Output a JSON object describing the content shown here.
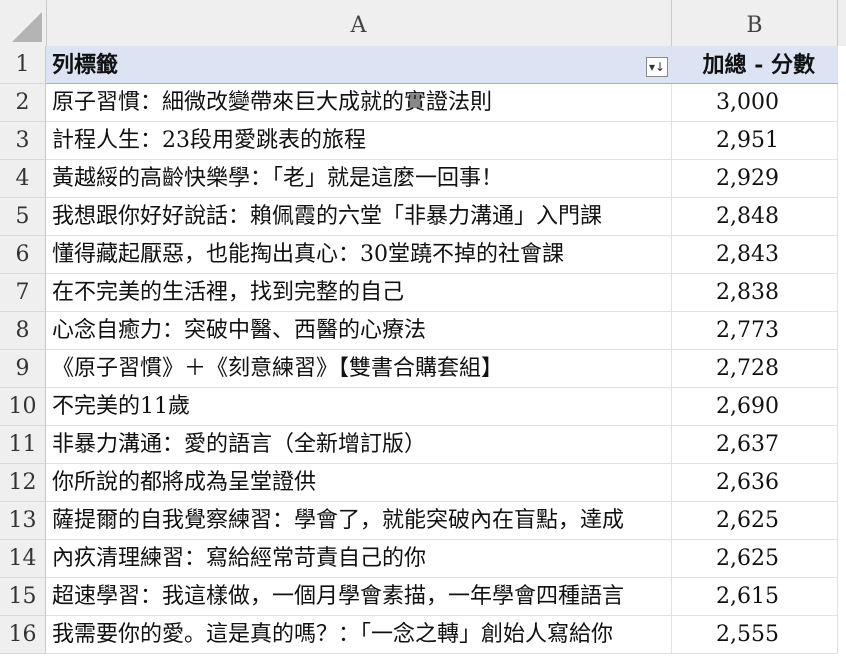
{
  "columns": {
    "a": "A",
    "b": "B"
  },
  "header": {
    "label": "列標籤",
    "value_label": "加總 - 分數",
    "filter_icon": "filter-sort-icon"
  },
  "rows": [
    {
      "num": "2",
      "title": "原子習慣：細微改變帶來巨大成就的實證法則",
      "score": "3,000"
    },
    {
      "num": "3",
      "title": "計程人生：23段用愛跳表的旅程",
      "score": "2,951"
    },
    {
      "num": "4",
      "title": "黃越綏的高齡快樂學：「老」就是這麼一回事！",
      "score": "2,929"
    },
    {
      "num": "5",
      "title": "我想跟你好好說話：賴佩霞的六堂「非暴力溝通」入門課",
      "score": "2,848"
    },
    {
      "num": "6",
      "title": "懂得藏起厭惡，也能掏出真心：30堂蹺不掉的社會課",
      "score": "2,843"
    },
    {
      "num": "7",
      "title": "在不完美的生活裡，找到完整的自己",
      "score": "2,838"
    },
    {
      "num": "8",
      "title": "心念自癒力：突破中醫、西醫的心療法",
      "score": "2,773"
    },
    {
      "num": "9",
      "title": "《原子習慣》＋《刻意練習》【雙書合購套組】",
      "score": "2,728"
    },
    {
      "num": "10",
      "title": "不完美的11歲",
      "score": "2,690"
    },
    {
      "num": "11",
      "title": "非暴力溝通：愛的語言（全新增訂版）",
      "score": "2,637"
    },
    {
      "num": "12",
      "title": "你所說的都將成為呈堂證供",
      "score": "2,636"
    },
    {
      "num": "13",
      "title": "薩提爾的自我覺察練習：學會了，就能突破內在盲點，達成",
      "score": "2,625"
    },
    {
      "num": "14",
      "title": "內疚清理練習：寫給經常苛責自己的你",
      "score": "2,625"
    },
    {
      "num": "15",
      "title": "超速學習：我這樣做，一個月學會素描，一年學會四種語言",
      "score": "2,615"
    },
    {
      "num": "16",
      "title": "我需要你的愛。這是真的嗎？：「一念之轉」創始人寫給你",
      "score": "2,555"
    }
  ],
  "header_row_num": "1"
}
